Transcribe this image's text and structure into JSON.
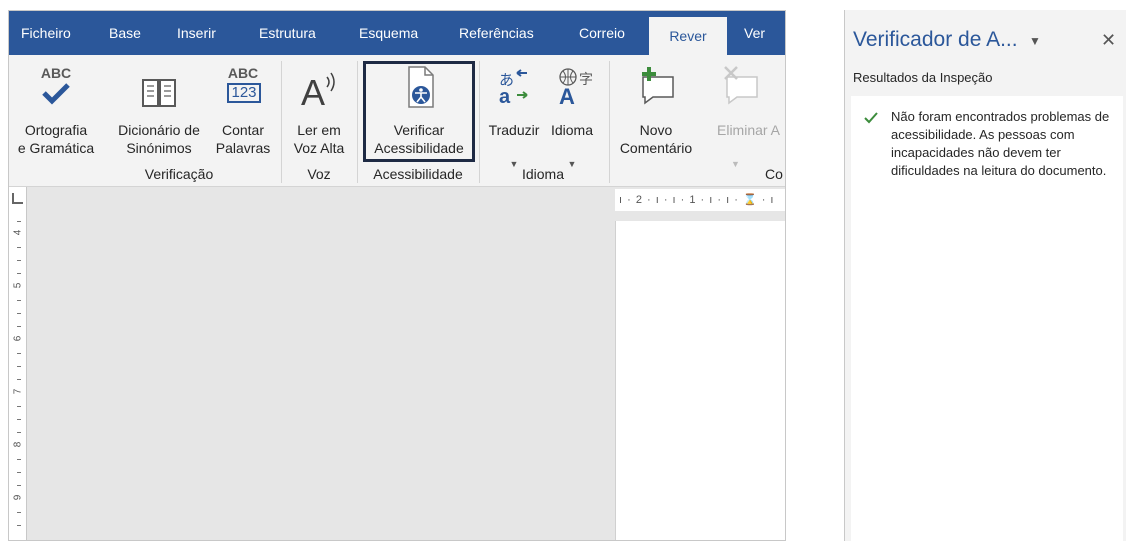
{
  "tabs": [
    "Ficheiro",
    "Base",
    "Inserir",
    "Estrutura",
    "Esquema",
    "Referências",
    "Correio",
    "Rever",
    "Ver"
  ],
  "active_tab": "Rever",
  "ribbon": {
    "spelling": {
      "icon_text": "ABC",
      "line1": "Ortografia",
      "line2": "e Gramática"
    },
    "thesaurus": {
      "line1": "Dicionário de",
      "line2": "Sinónimos"
    },
    "wordcount": {
      "icon_text_top": "ABC",
      "icon_text_bottom": "123",
      "line1": "Contar",
      "line2": "Palavras"
    },
    "read_aloud": {
      "line1": "Ler em",
      "line2": "Voz Alta"
    },
    "check_accessibility": {
      "line1": "Verificar",
      "line2": "Acessibilidade"
    },
    "translate": {
      "line1": "Traduzir"
    },
    "language": {
      "line1": "Idioma"
    },
    "new_comment": {
      "line1": "Novo",
      "line2": "Comentário"
    },
    "delete_comment": {
      "line1": "Eliminar A"
    },
    "groups": {
      "proofing": "Verificação",
      "speech": "Voz",
      "accessibility": "Acessibilidade",
      "language": "Idioma",
      "comments": "Co"
    }
  },
  "ruler": {
    "horizontal": "ı · 2 · ı · ı · 1 · ı · ı · ⌛ · ı",
    "vertical_numbers": [
      "4",
      "5",
      "6",
      "7",
      "8",
      "9"
    ]
  },
  "pane": {
    "title": "Verificador de A...",
    "dropdown_glyph": "▼",
    "close_glyph": "✕",
    "subtitle": "Resultados da Inspeção",
    "result": "Não foram encontrados problemas de acessibilidade. As pessoas com incapacidades não devem ter dificuldades na leitura do documento."
  },
  "colors": {
    "word_blue": "#2b579a",
    "ribbon_bg": "#f3f3f3",
    "check_green": "#3c8c3c",
    "highlight_border": "#1e2a44"
  }
}
